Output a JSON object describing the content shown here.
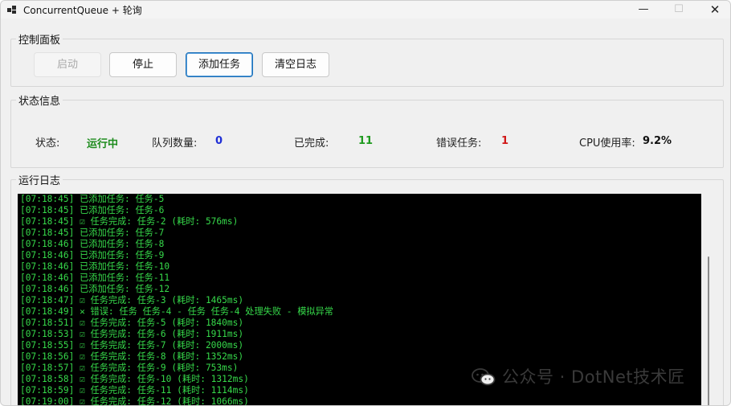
{
  "window": {
    "title": "ConcurrentQueue + 轮询",
    "minimize": "—",
    "maximize": "☐",
    "close": "✕"
  },
  "control_panel": {
    "title": "控制面板",
    "buttons": {
      "start": "启动",
      "stop": "停止",
      "add_task": "添加任务",
      "clear_log": "清空日志"
    }
  },
  "status": {
    "title": "状态信息",
    "state_label": "状态:",
    "state_value": "运行中",
    "queue_label": "队列数量:",
    "queue_value": "0",
    "completed_label": "已完成:",
    "completed_value": "11",
    "error_label": "错误任务:",
    "error_value": "1",
    "cpu_label": "CPU使用率:",
    "cpu_value": "9.2%"
  },
  "log": {
    "title": "运行日志",
    "lines": [
      "[07:18:45] 已添加任务: 任务-5",
      "[07:18:45] 已添加任务: 任务-6",
      "[07:18:45] ☑ 任务完成: 任务-2 (耗时: 576ms)",
      "[07:18:45] 已添加任务: 任务-7",
      "[07:18:46] 已添加任务: 任务-8",
      "[07:18:46] 已添加任务: 任务-9",
      "[07:18:46] 已添加任务: 任务-10",
      "[07:18:46] 已添加任务: 任务-11",
      "[07:18:46] 已添加任务: 任务-12",
      "[07:18:47] ☑ 任务完成: 任务-3 (耗时: 1465ms)",
      "[07:18:49] ✕ 错误: 任务 任务-4 - 任务 任务-4 处理失败 - 模拟异常",
      "[07:18:51] ☑ 任务完成: 任务-5 (耗时: 1840ms)",
      "[07:18:53] ☑ 任务完成: 任务-6 (耗时: 1911ms)",
      "[07:18:55] ☑ 任务完成: 任务-7 (耗时: 2000ms)",
      "[07:18:56] ☑ 任务完成: 任务-8 (耗时: 1352ms)",
      "[07:18:57] ☑ 任务完成: 任务-9 (耗时: 753ms)",
      "[07:18:58] ☑ 任务完成: 任务-10 (耗时: 1312ms)",
      "[07:18:59] ☑ 任务完成: 任务-11 (耗时: 1114ms)",
      "[07:19:00] ☑ 任务完成: 任务-12 (耗时: 1066ms)"
    ]
  },
  "watermark": {
    "text": "公众号 · DotNet技术匠"
  },
  "colors": {
    "running_green": "#1e8c1e",
    "queue_blue": "#1f2fd6",
    "completed_green": "#1e9a1e",
    "error_red": "#d01818",
    "log_green": "#36d94a",
    "focus_blue": "#1a6fb8"
  }
}
